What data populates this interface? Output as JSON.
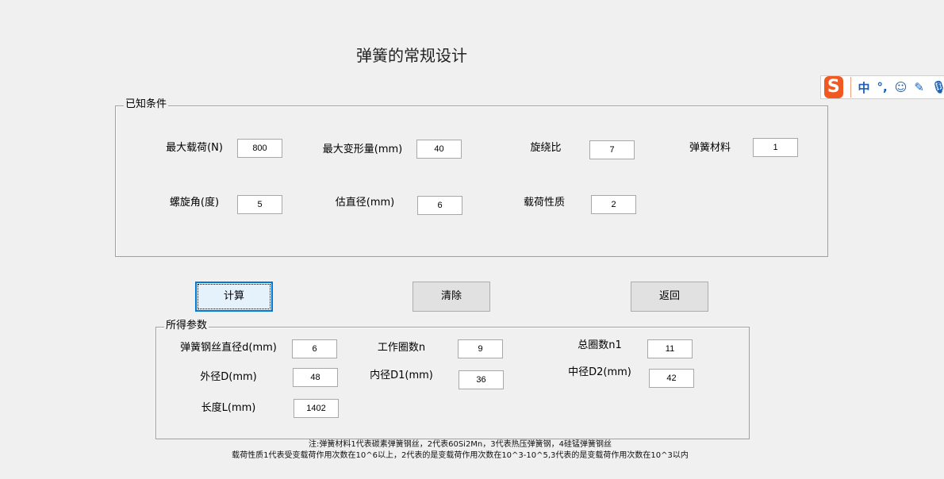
{
  "title": "弹簧的常规设计",
  "known": {
    "label": "已知条件",
    "fields": [
      {
        "label": "最大载荷(N)",
        "value": "800"
      },
      {
        "label": "最大变形量(mm)",
        "value": "40"
      },
      {
        "label": "旋绕比",
        "value": "7"
      },
      {
        "label": "弹簧材料",
        "value": "1"
      },
      {
        "label": "螺旋角(度)",
        "value": "5"
      },
      {
        "label": "估直径(mm)",
        "value": "6"
      },
      {
        "label": "载荷性质",
        "value": "2"
      }
    ]
  },
  "buttons": {
    "calc": "计算",
    "clear": "清除",
    "back": "返回"
  },
  "results": {
    "label": "所得参数",
    "fields": [
      {
        "label": "弹簧钢丝直径d(mm)",
        "value": "6"
      },
      {
        "label": "工作圈数n",
        "value": "9"
      },
      {
        "label": "总圈数n1",
        "value": "11"
      },
      {
        "label": "外径D(mm)",
        "value": "48"
      },
      {
        "label": "内径D1(mm)",
        "value": "36"
      },
      {
        "label": "中径D2(mm)",
        "value": "42"
      },
      {
        "label": "长度L(mm)",
        "value": "1402"
      }
    ]
  },
  "notes": [
    "注:弹簧材料1代表碳素弹簧钢丝，2代表60Si2Mn，3代表热压弹簧钢，4硅锰弹簧钢丝",
    "载荷性质1代表受变载荷作用次数在10^6以上，2代表的是变载荷作用次数在10^3-10^5,3代表的是变载荷作用次数在10^3以内"
  ],
  "ime": {
    "logo": "S",
    "lang": "中",
    "punct": "°,",
    "emoji": "☺",
    "pen": "✎",
    "mic": "🎙"
  }
}
